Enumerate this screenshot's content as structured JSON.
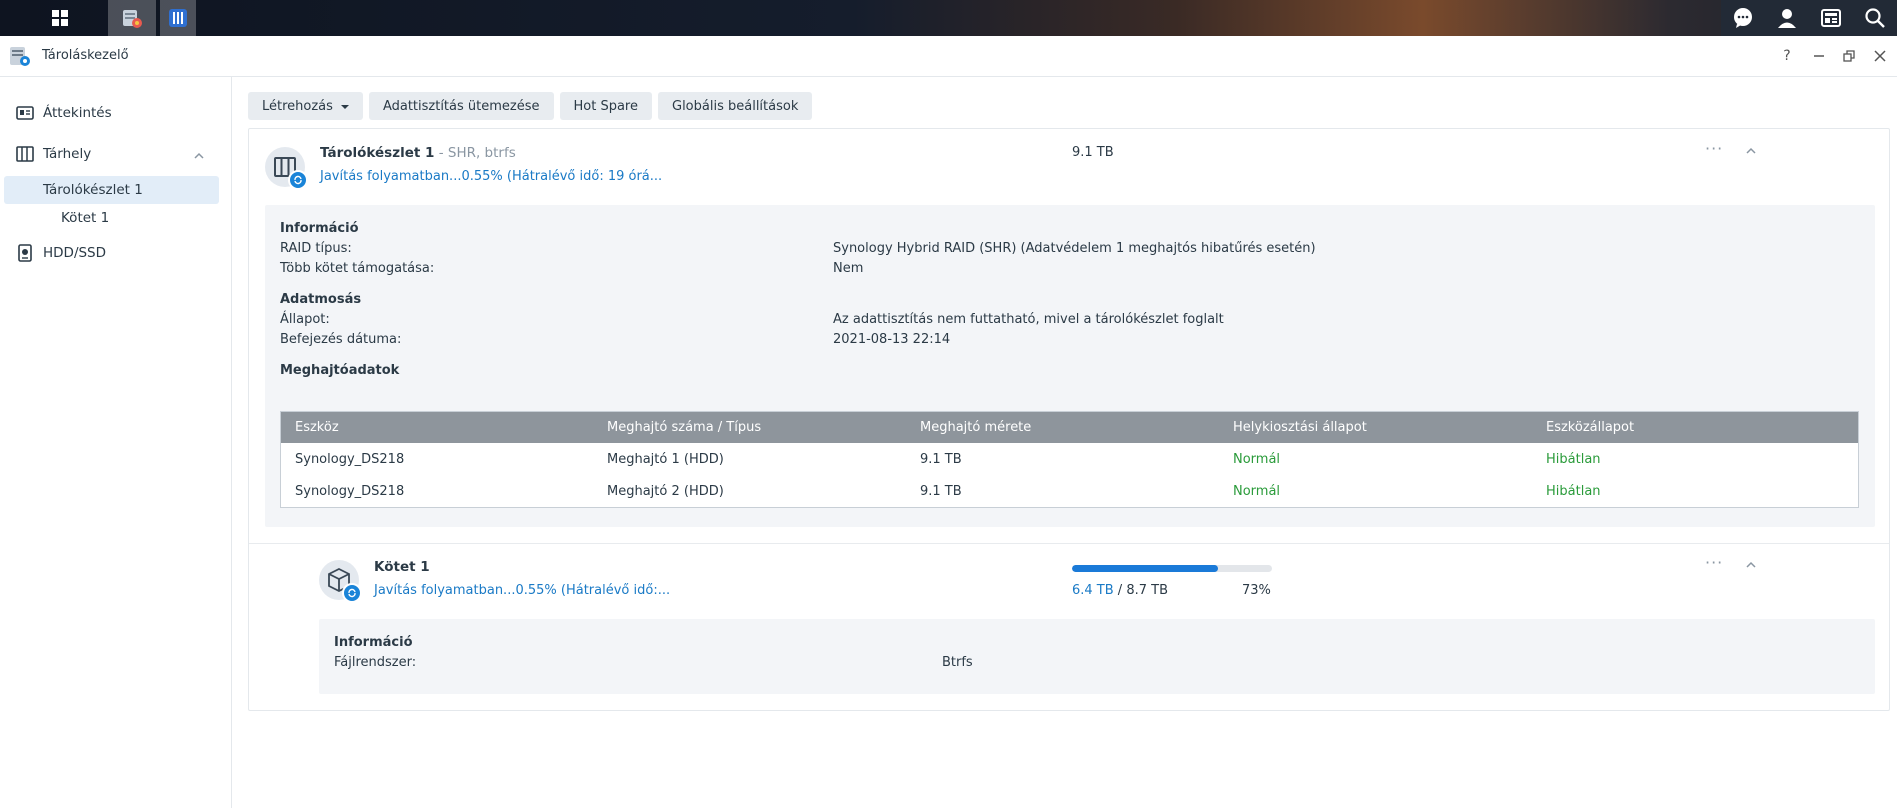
{
  "app": {
    "title": "Tároláskezelő"
  },
  "sidebar": {
    "overview": "Áttekintés",
    "storage": "Tárhely",
    "pool": "Tárolókészlet 1",
    "volume": "Kötet 1",
    "hdd": "HDD/SSD"
  },
  "toolbar": {
    "create": "Létrehozás",
    "scrub_schedule": "Adattisztítás ütemezése",
    "hot_spare": "Hot Spare",
    "global_settings": "Globális beállítások"
  },
  "pool": {
    "name": "Tárolókészlet 1",
    "subtitle": " - SHR, btrfs",
    "status": "Javítás folyamatban...0.55% (Hátralévő idő: 19 órá...",
    "capacity": "9.1 TB",
    "info": {
      "heading": "Információ",
      "raid_label": "RAID típus:",
      "raid_value": "Synology Hybrid RAID (SHR) (Adatvédelem 1 meghajtós hibatűrés esetén)",
      "multi_label": "Több kötet támogatása:",
      "multi_value": "Nem"
    },
    "scrub": {
      "heading": "Adatmosás",
      "state_label": "Állapot:",
      "state_value": "Az adattisztítás nem futtatható, mivel a tárolókészlet foglalt",
      "finish_label": "Befejezés dátuma:",
      "finish_value": "2021-08-13 22:14"
    },
    "drives": {
      "heading": "Meghajtóadatok",
      "columns": [
        "Eszköz",
        "Meghajtó száma / Típus",
        "Meghajtó mérete",
        "Helykiosztási állapot",
        "Eszközállapot"
      ],
      "rows": [
        [
          "Synology_DS218",
          "Meghajtó 1 (HDD)",
          "9.1 TB",
          "Normál",
          "Hibátlan"
        ],
        [
          "Synology_DS218",
          "Meghajtó 2 (HDD)",
          "9.1 TB",
          "Normál",
          "Hibátlan"
        ]
      ]
    }
  },
  "volume": {
    "name": "Kötet 1",
    "status": "Javítás folyamatban...0.55% (Hátralévő idő:...",
    "used": "6.4 TB",
    "separator": " / ",
    "total": "8.7 TB",
    "percent": "73%",
    "usage_fraction": 0.73,
    "info": {
      "heading": "Információ",
      "fs_label": "Fájlrendszer:",
      "fs_value": "Btrfs"
    }
  },
  "icons": {
    "taskbar": [
      "grid-icon",
      "storage-manager-icon",
      "package-icon"
    ],
    "tray": [
      "chat-icon",
      "user-icon",
      "widgets-icon",
      "search-icon"
    ]
  },
  "colors": {
    "accent": "#1a7ac6",
    "ok": "#2a9b3a",
    "table_header": "#8e959c"
  }
}
